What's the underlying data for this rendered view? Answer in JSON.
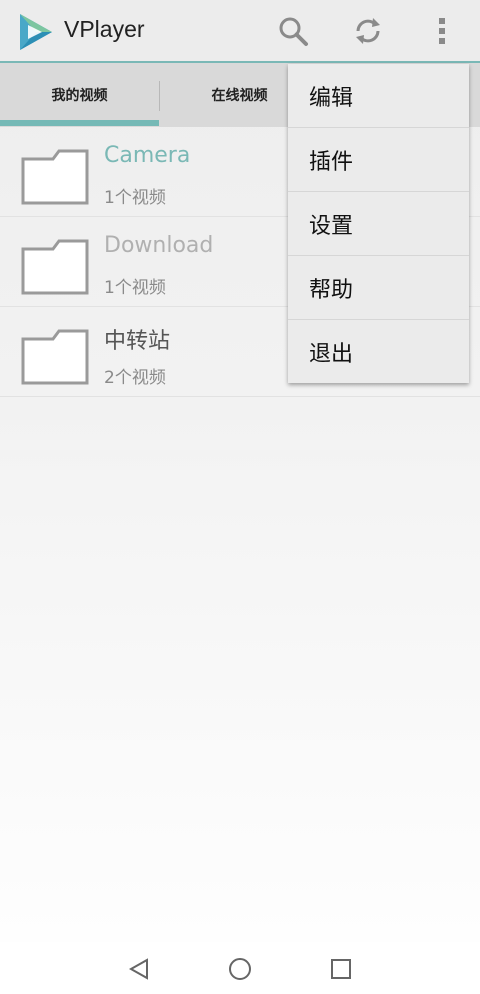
{
  "app": {
    "title": "VPlayer"
  },
  "toolbar": {
    "icons": [
      "search-icon",
      "refresh-icon",
      "more-vert-icon"
    ]
  },
  "tabs": [
    {
      "label": "我的视频",
      "selected": true
    },
    {
      "label": "在线视频",
      "selected": false
    }
  ],
  "folders": [
    {
      "name": "Camera",
      "count": "1个视频",
      "color": "#7ab8b5"
    },
    {
      "name": "Download",
      "count": "1个视频",
      "color": "#b0b0b0"
    },
    {
      "name": "中转站",
      "count": "2个视频",
      "color": "#555555"
    }
  ],
  "menu": {
    "items": [
      "编辑",
      "插件",
      "设置",
      "帮助",
      "退出"
    ]
  },
  "navbar": {
    "icons": [
      "back-icon",
      "home-icon",
      "recents-icon"
    ]
  },
  "colors": {
    "accent": "#75b9b6",
    "appbar": "#ececec",
    "tabbar": "#d9d9d9"
  }
}
